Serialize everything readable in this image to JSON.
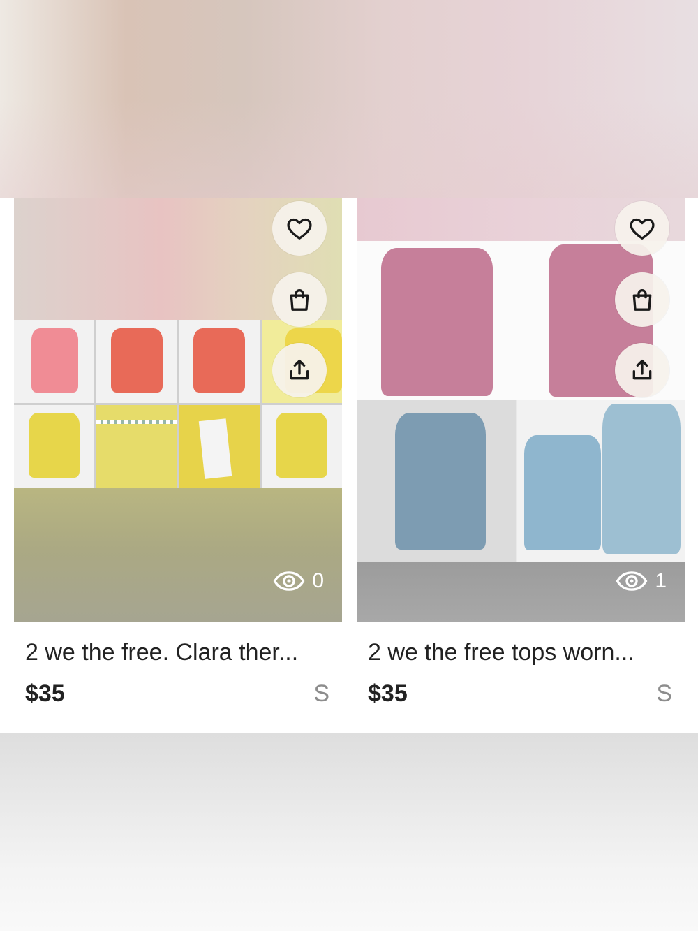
{
  "listings": [
    {
      "title": "2 we the free. Clara ther...",
      "price": "$35",
      "size": "S",
      "views": "0",
      "actions": {
        "like_icon": "heart-icon",
        "bag_icon": "shopping-bag-icon",
        "share_icon": "share-icon",
        "views_icon": "eye-icon"
      }
    },
    {
      "title": "2 we the free tops worn...",
      "price": "$35",
      "size": "S",
      "views": "1",
      "actions": {
        "like_icon": "heart-icon",
        "bag_icon": "shopping-bag-icon",
        "share_icon": "share-icon",
        "views_icon": "eye-icon"
      }
    }
  ]
}
